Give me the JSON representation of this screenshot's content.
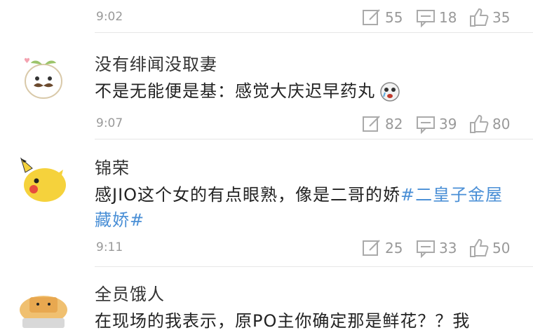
{
  "posts": [
    {
      "time": "9:02",
      "repost_count": "55",
      "comment_count": "18",
      "like_count": "35"
    },
    {
      "username": "没有绯闻没取妻",
      "text": "不是无能便是基：感觉大庆迟早药丸",
      "time": "9:07",
      "repost_count": "82",
      "comment_count": "39",
      "like_count": "80",
      "emoji_icon": "crying-face-emoji"
    },
    {
      "username": "锦荣",
      "text_plain": "感JIO这个女的有点眼熟，像是二哥的娇",
      "hashtag": "#二皇子金屋藏娇#",
      "time": "9:11",
      "repost_count": "25",
      "comment_count": "33",
      "like_count": "50"
    },
    {
      "username": "全员饿人",
      "text": "在现场的我表示，原PO主你确定那是鲜花？？我"
    }
  ],
  "colors": {
    "meta_gray": "#999999",
    "hashtag_blue": "#4a8fd6",
    "divider": "#e6e6e6"
  },
  "icons": [
    "repost-icon",
    "comment-icon",
    "like-icon"
  ]
}
